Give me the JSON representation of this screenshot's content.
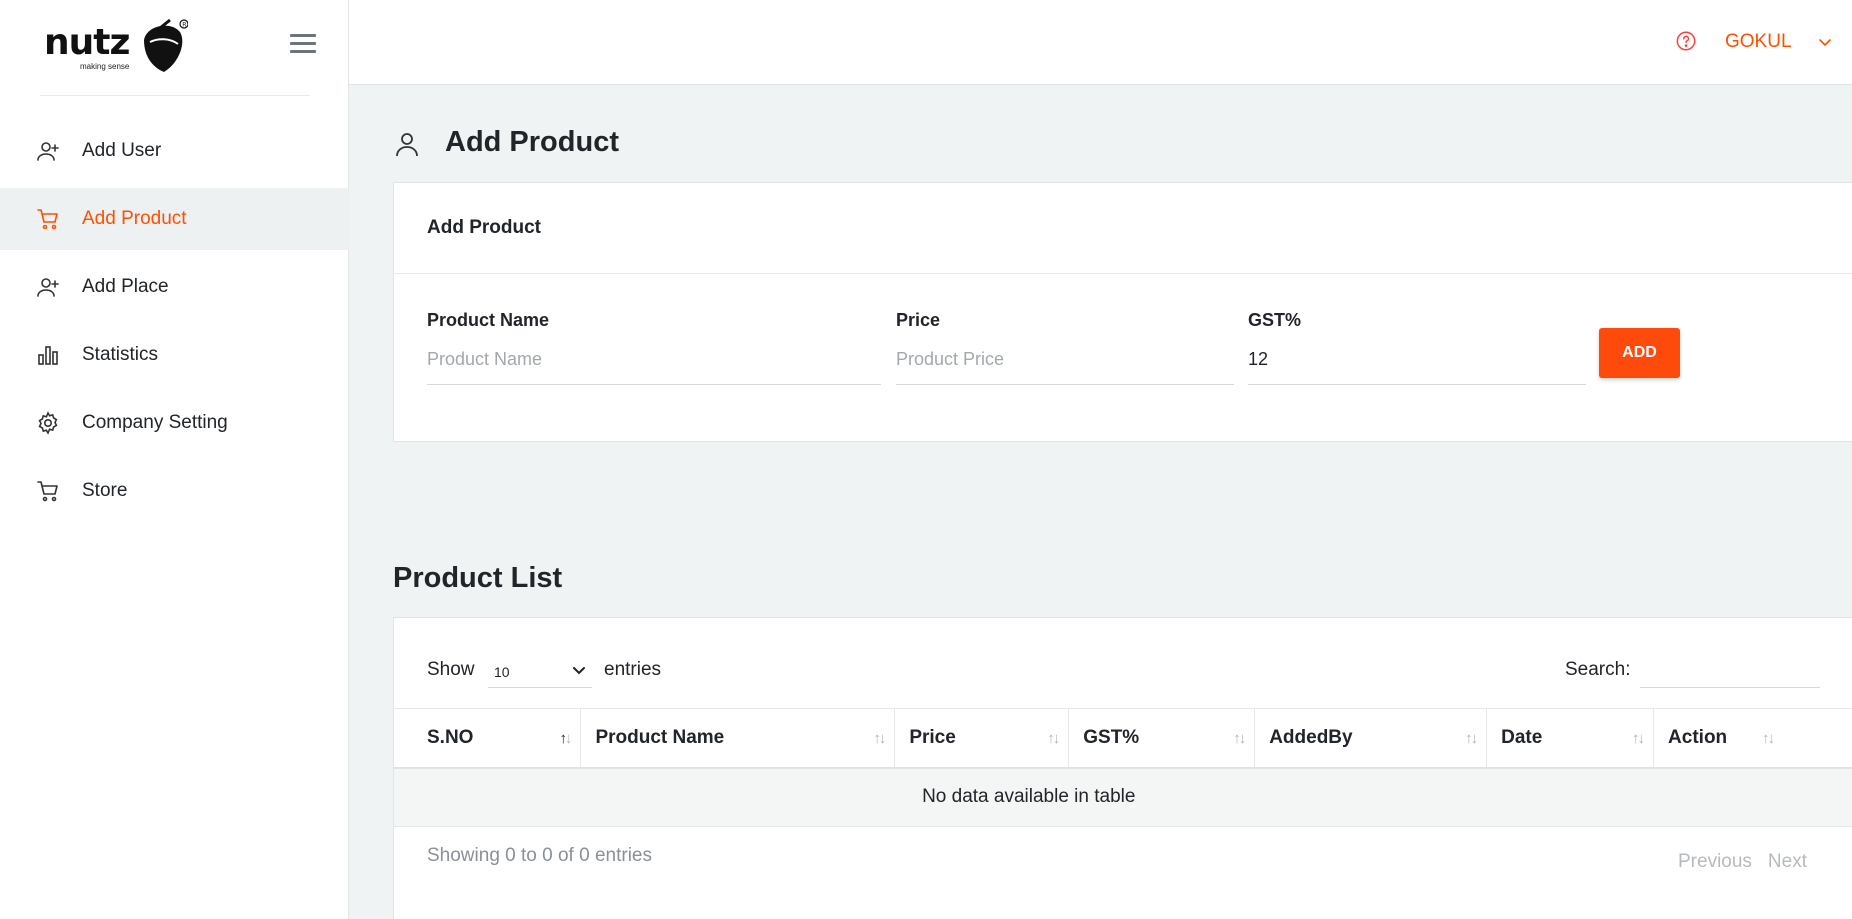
{
  "brand": {
    "name": "nutz",
    "tagline": "making sense",
    "accent": "#fe5000"
  },
  "sidebar": {
    "items": [
      {
        "label": "Add User",
        "icon": "user-plus-icon",
        "active": false
      },
      {
        "label": "Add Product",
        "icon": "cart-icon",
        "active": true
      },
      {
        "label": "Add Place",
        "icon": "user-plus-icon",
        "active": false
      },
      {
        "label": "Statistics",
        "icon": "bar-chart-icon",
        "active": false
      },
      {
        "label": "Company Setting",
        "icon": "gear-icon",
        "active": false
      },
      {
        "label": "Store",
        "icon": "cart-icon",
        "active": false
      }
    ]
  },
  "header": {
    "user": "GOKUL",
    "help_icon": "help-circle-icon"
  },
  "page": {
    "title": "Add Product"
  },
  "form": {
    "card_title": "Add Product",
    "fields": [
      {
        "label": "Product Name",
        "placeholder": "Product Name",
        "value": ""
      },
      {
        "label": "Price",
        "placeholder": "Product Price",
        "value": ""
      },
      {
        "label": "GST%",
        "placeholder": "",
        "value": "12"
      }
    ],
    "add_label": "ADD"
  },
  "list": {
    "title": "Product List",
    "show_label": "Show",
    "length_value": "10",
    "entries_label": "entries",
    "search_label": "Search:",
    "columns": [
      "S.NO",
      "Product Name",
      "Price",
      "GST%",
      "AddedBy",
      "Date",
      "Action"
    ],
    "empty_text": "No data available in table",
    "info": "Showing 0 to 0 of 0 entries",
    "previous": "Previous",
    "next": "Next"
  }
}
